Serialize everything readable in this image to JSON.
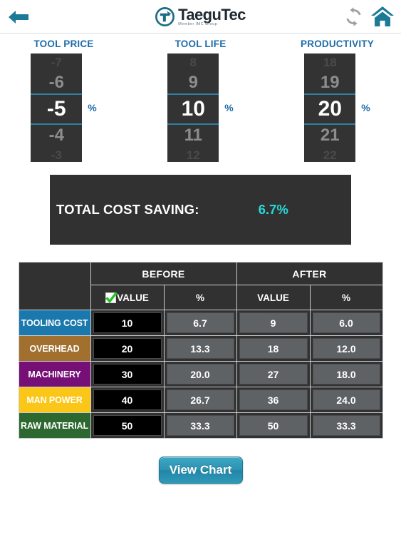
{
  "topbar": {
    "back_icon": "back-arrow-icon",
    "refresh_icon": "refresh-icon",
    "home_icon": "home-icon",
    "brand_name": "TaeguTec",
    "brand_sub": "Member IMC Group",
    "accent_teal": "#1c7a96",
    "accent_blue": "#1e6ca8"
  },
  "pickers": [
    {
      "label": "TOOL PRICE",
      "unit": "%",
      "far_above": "-7",
      "near_above": "-6",
      "selected": "-5",
      "near_below": "-4",
      "far_below": "-3"
    },
    {
      "label": "TOOL LIFE",
      "unit": "%",
      "far_above": "8",
      "near_above": "9",
      "selected": "10",
      "near_below": "11",
      "far_below": "12"
    },
    {
      "label": "PRODUCTIVITY",
      "unit": "%",
      "far_above": "18",
      "near_above": "19",
      "selected": "20",
      "near_below": "21",
      "far_below": "22"
    }
  ],
  "saving": {
    "label": "TOTAL COST SAVING:",
    "value": "6.7%",
    "value_color": "#27d8d8"
  },
  "table": {
    "group_headers": [
      "BEFORE",
      "AFTER"
    ],
    "sub_headers": [
      "VALUE",
      "%",
      "VALUE",
      "%"
    ],
    "checkbox_checked": true,
    "rows": [
      {
        "label": "TOOLING COST",
        "color": "#1a78ad",
        "before_value": "10",
        "before_pct": "6.7",
        "after_value": "9",
        "after_pct": "6.0"
      },
      {
        "label": "OVERHEAD",
        "color": "#a1702f",
        "before_value": "20",
        "before_pct": "13.3",
        "after_value": "18",
        "after_pct": "12.0"
      },
      {
        "label": "MACHINERY",
        "color": "#760f76",
        "before_value": "30",
        "before_pct": "20.0",
        "after_value": "27",
        "after_pct": "18.0"
      },
      {
        "label": "MAN POWER",
        "color": "#fac618",
        "color_text": "#ffffff",
        "before_value": "40",
        "before_pct": "26.7",
        "after_value": "36",
        "after_pct": "24.0"
      },
      {
        "label": "RAW MATERIAL",
        "color": "#2c682f",
        "before_value": "50",
        "before_pct": "33.3",
        "after_value": "50",
        "after_pct": "33.3"
      }
    ]
  },
  "footer": {
    "view_chart_label": "View Chart"
  }
}
